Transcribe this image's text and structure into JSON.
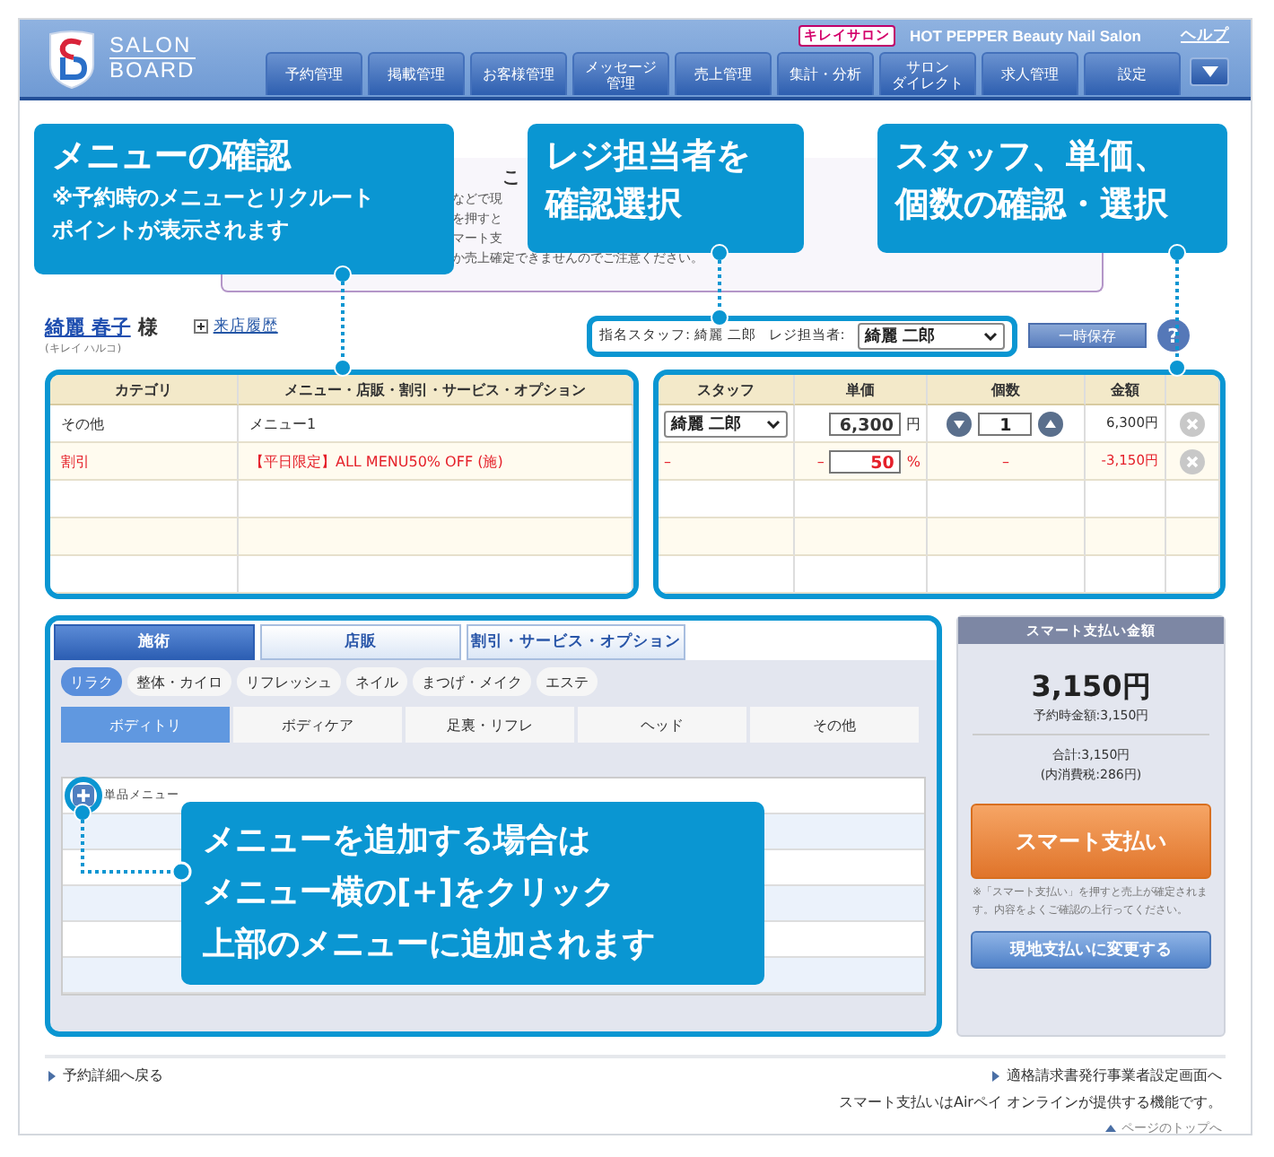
{
  "header": {
    "logo": {
      "line1": "SALON",
      "line2": "BOARD"
    },
    "badge": "キレイサロン",
    "site_name": "HOT PEPPER Beauty Nail Salon",
    "help": "ヘルプ",
    "nav": [
      {
        "lines": [
          "予約管理"
        ]
      },
      {
        "lines": [
          "掲載管理"
        ]
      },
      {
        "lines": [
          "お客様管理"
        ]
      },
      {
        "lines": [
          "メッセージ",
          "管理"
        ]
      },
      {
        "lines": [
          "売上管理"
        ]
      },
      {
        "lines": [
          "集計・分析"
        ]
      },
      {
        "lines": [
          "サロン",
          "ダイレクト"
        ]
      },
      {
        "lines": [
          "求人管理"
        ]
      },
      {
        "lines": [
          "設定"
        ]
      }
    ]
  },
  "notice": {
    "heading": "こ",
    "lines": [
      "などで現",
      "を押すと",
      "マート支",
      "か売上確定できませんのでご注意ください。"
    ]
  },
  "customer": {
    "name": "綺麗 春子",
    "honorific": "様",
    "kana": "(キレイ ハルコ)",
    "history_link": "来店履歴",
    "assigned_staff_label": "指名スタッフ:",
    "assigned_staff": "綺麗 二郎",
    "cashier_label": "レジ担当者:",
    "cashier": "綺麗 二郎",
    "save_button": "一時保存",
    "help_button": "?"
  },
  "table": {
    "left_columns": [
      "カテゴリ",
      "メニュー・店販・割引・サービス・オプション"
    ],
    "right_columns": [
      "スタッフ",
      "単価",
      "個数",
      "金額"
    ],
    "rows": [
      {
        "kind": "item",
        "category": "その他",
        "menu": "メニュー1",
        "staff": "綺麗 二郎",
        "price": "6,300",
        "price_unit": "円",
        "qty": "1",
        "amount": "6,300円"
      },
      {
        "kind": "discount",
        "category": "割引",
        "menu": "【平日限定】ALL MENU50% OFF (施)",
        "staff": "–",
        "price_prefix": "–",
        "price": "50",
        "price_unit": "%",
        "qty": "–",
        "amount": "-3,150円"
      }
    ]
  },
  "menu_panel": {
    "tabs": [
      {
        "label": "施術",
        "selected": true
      },
      {
        "label": "店販",
        "selected": false
      },
      {
        "label": "割引・サービス・オプション",
        "selected": false
      }
    ],
    "chips": [
      {
        "label": "リラク",
        "selected": true
      },
      {
        "label": "整体・カイロ",
        "selected": false
      },
      {
        "label": "リフレッシュ",
        "selected": false
      },
      {
        "label": "ネイル",
        "selected": false
      },
      {
        "label": "まつげ・メイク",
        "selected": false
      },
      {
        "label": "エステ",
        "selected": false
      }
    ],
    "subtabs": [
      {
        "label": "ボディトリ",
        "selected": true
      },
      {
        "label": "ボディケア",
        "selected": false
      },
      {
        "label": "足裏・リフレ",
        "selected": false
      },
      {
        "label": "ヘッド",
        "selected": false
      },
      {
        "label": "その他",
        "selected": false
      }
    ],
    "items": [
      "単品メニュー"
    ]
  },
  "payment": {
    "title": "スマート支払い金額",
    "amount": "3,150円",
    "reserved": "予約時金額:3,150円",
    "total": "合計:3,150円",
    "tax": "(内消費税:286円)",
    "smart_button": "スマート支払い",
    "note": "※「スマート支払い」を押すと売上が確定されます。内容をよくご確認の上行ってください。",
    "onsite_button": "現地支払いに変更する"
  },
  "footer": {
    "back_link": "予約詳細へ戻る",
    "invoice_link": "適格請求書発行事業者設定画面へ",
    "provider_note": "スマート支払いはAirペイ オンラインが提供する機能です。",
    "top_link": "ページのトップへ"
  },
  "callouts": [
    {
      "lines": [
        "メニューの確認"
      ],
      "note_lines": [
        "※予約時のメニューとリクルート",
        "ポイントが表示されます"
      ]
    },
    {
      "lines": [
        "レジ担当者を",
        "確認選択"
      ]
    },
    {
      "lines": [
        "スタッフ、単価、",
        "個数の確認・選択"
      ]
    },
    {
      "lines": [
        "メニューを追加する場合は",
        "メニュー横の[+]をクリック",
        "上部のメニューに追加されます"
      ]
    }
  ]
}
